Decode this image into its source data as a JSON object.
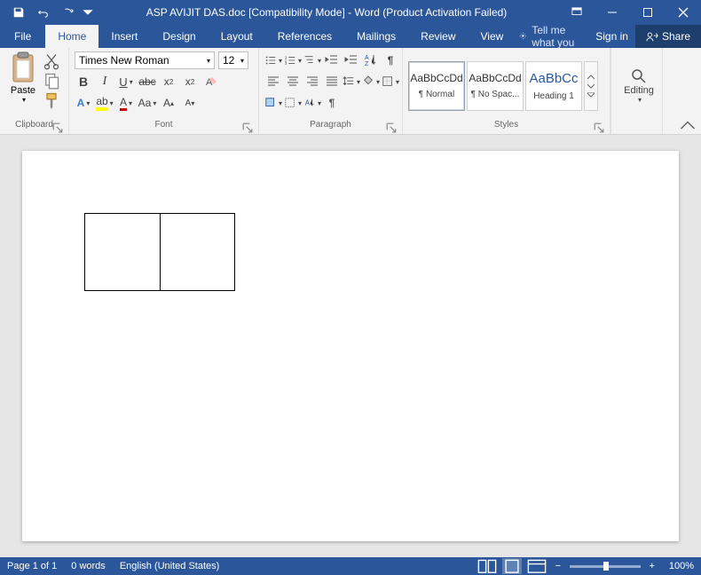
{
  "title": "ASP AVIJIT DAS.doc [Compatibility Mode] - Word (Product Activation Failed)",
  "tabs": {
    "file": "File",
    "home": "Home",
    "insert": "Insert",
    "design": "Design",
    "layout": "Layout",
    "references": "References",
    "mailings": "Mailings",
    "review": "Review",
    "view": "View"
  },
  "tellme": "Tell me what you",
  "signin": "Sign in",
  "share": "Share",
  "clipboard": {
    "paste": "Paste",
    "label": "Clipboard"
  },
  "font": {
    "name": "Times New Roman",
    "size": "12",
    "label": "Font"
  },
  "paragraph": {
    "label": "Paragraph"
  },
  "styles": {
    "label": "Styles",
    "items": [
      {
        "sample": "AaBbCcDd",
        "name": "¶ Normal"
      },
      {
        "sample": "AaBbCcDd",
        "name": "¶ No Spac..."
      },
      {
        "sample": "AaBbCc",
        "name": "Heading 1"
      }
    ]
  },
  "editing": {
    "label": "Editing"
  },
  "status": {
    "page": "Page 1 of 1",
    "words": "0 words",
    "lang": "English (United States)",
    "zoom": "100%"
  }
}
